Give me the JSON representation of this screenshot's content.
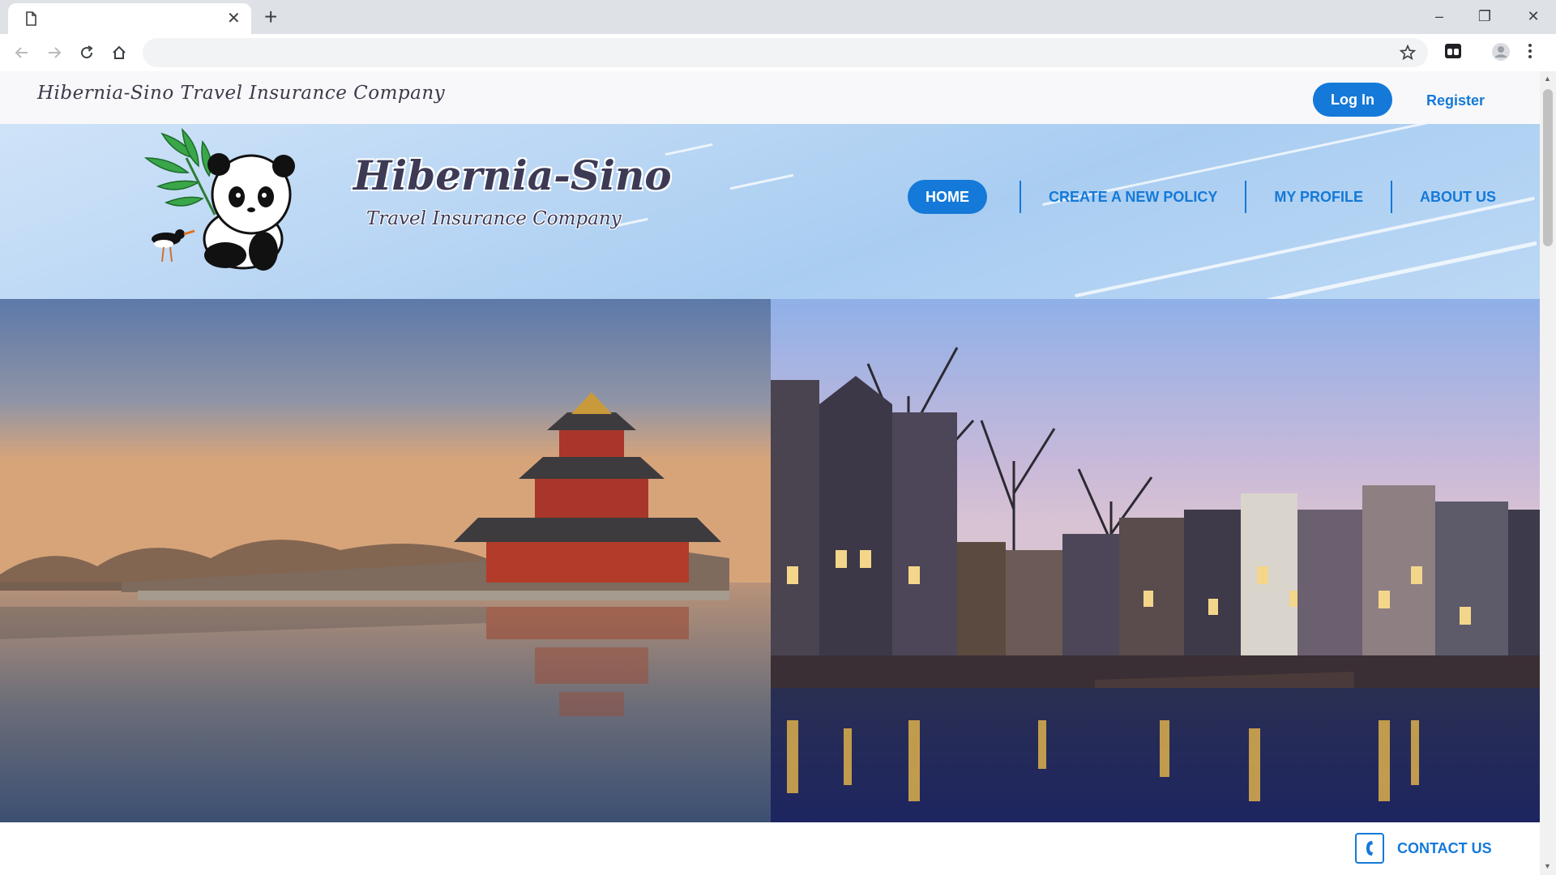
{
  "browser": {
    "tab_title": "",
    "tab_close": "✕",
    "new_tab": "+",
    "window_controls": {
      "minimize": "–",
      "maximize": "❐",
      "close": "✕"
    },
    "address": ""
  },
  "topbar": {
    "brand": "Hibernia-Sino Travel Insurance Company",
    "login_label": "Log In",
    "register_label": "Register"
  },
  "header": {
    "logo_title": "Hibernia-Sino",
    "logo_subtitle": "Travel Insurance Company",
    "nav": {
      "home": "HOME",
      "create_policy": "CREATE A NEW POLICY",
      "my_profile": "MY PROFILE",
      "about_us": "ABOUT US"
    }
  },
  "footer": {
    "contact_label": "CONTACT US"
  },
  "colors": {
    "accent": "#1479d8",
    "banner": "#b9d6f4",
    "topbar": "#f8f8fa"
  }
}
